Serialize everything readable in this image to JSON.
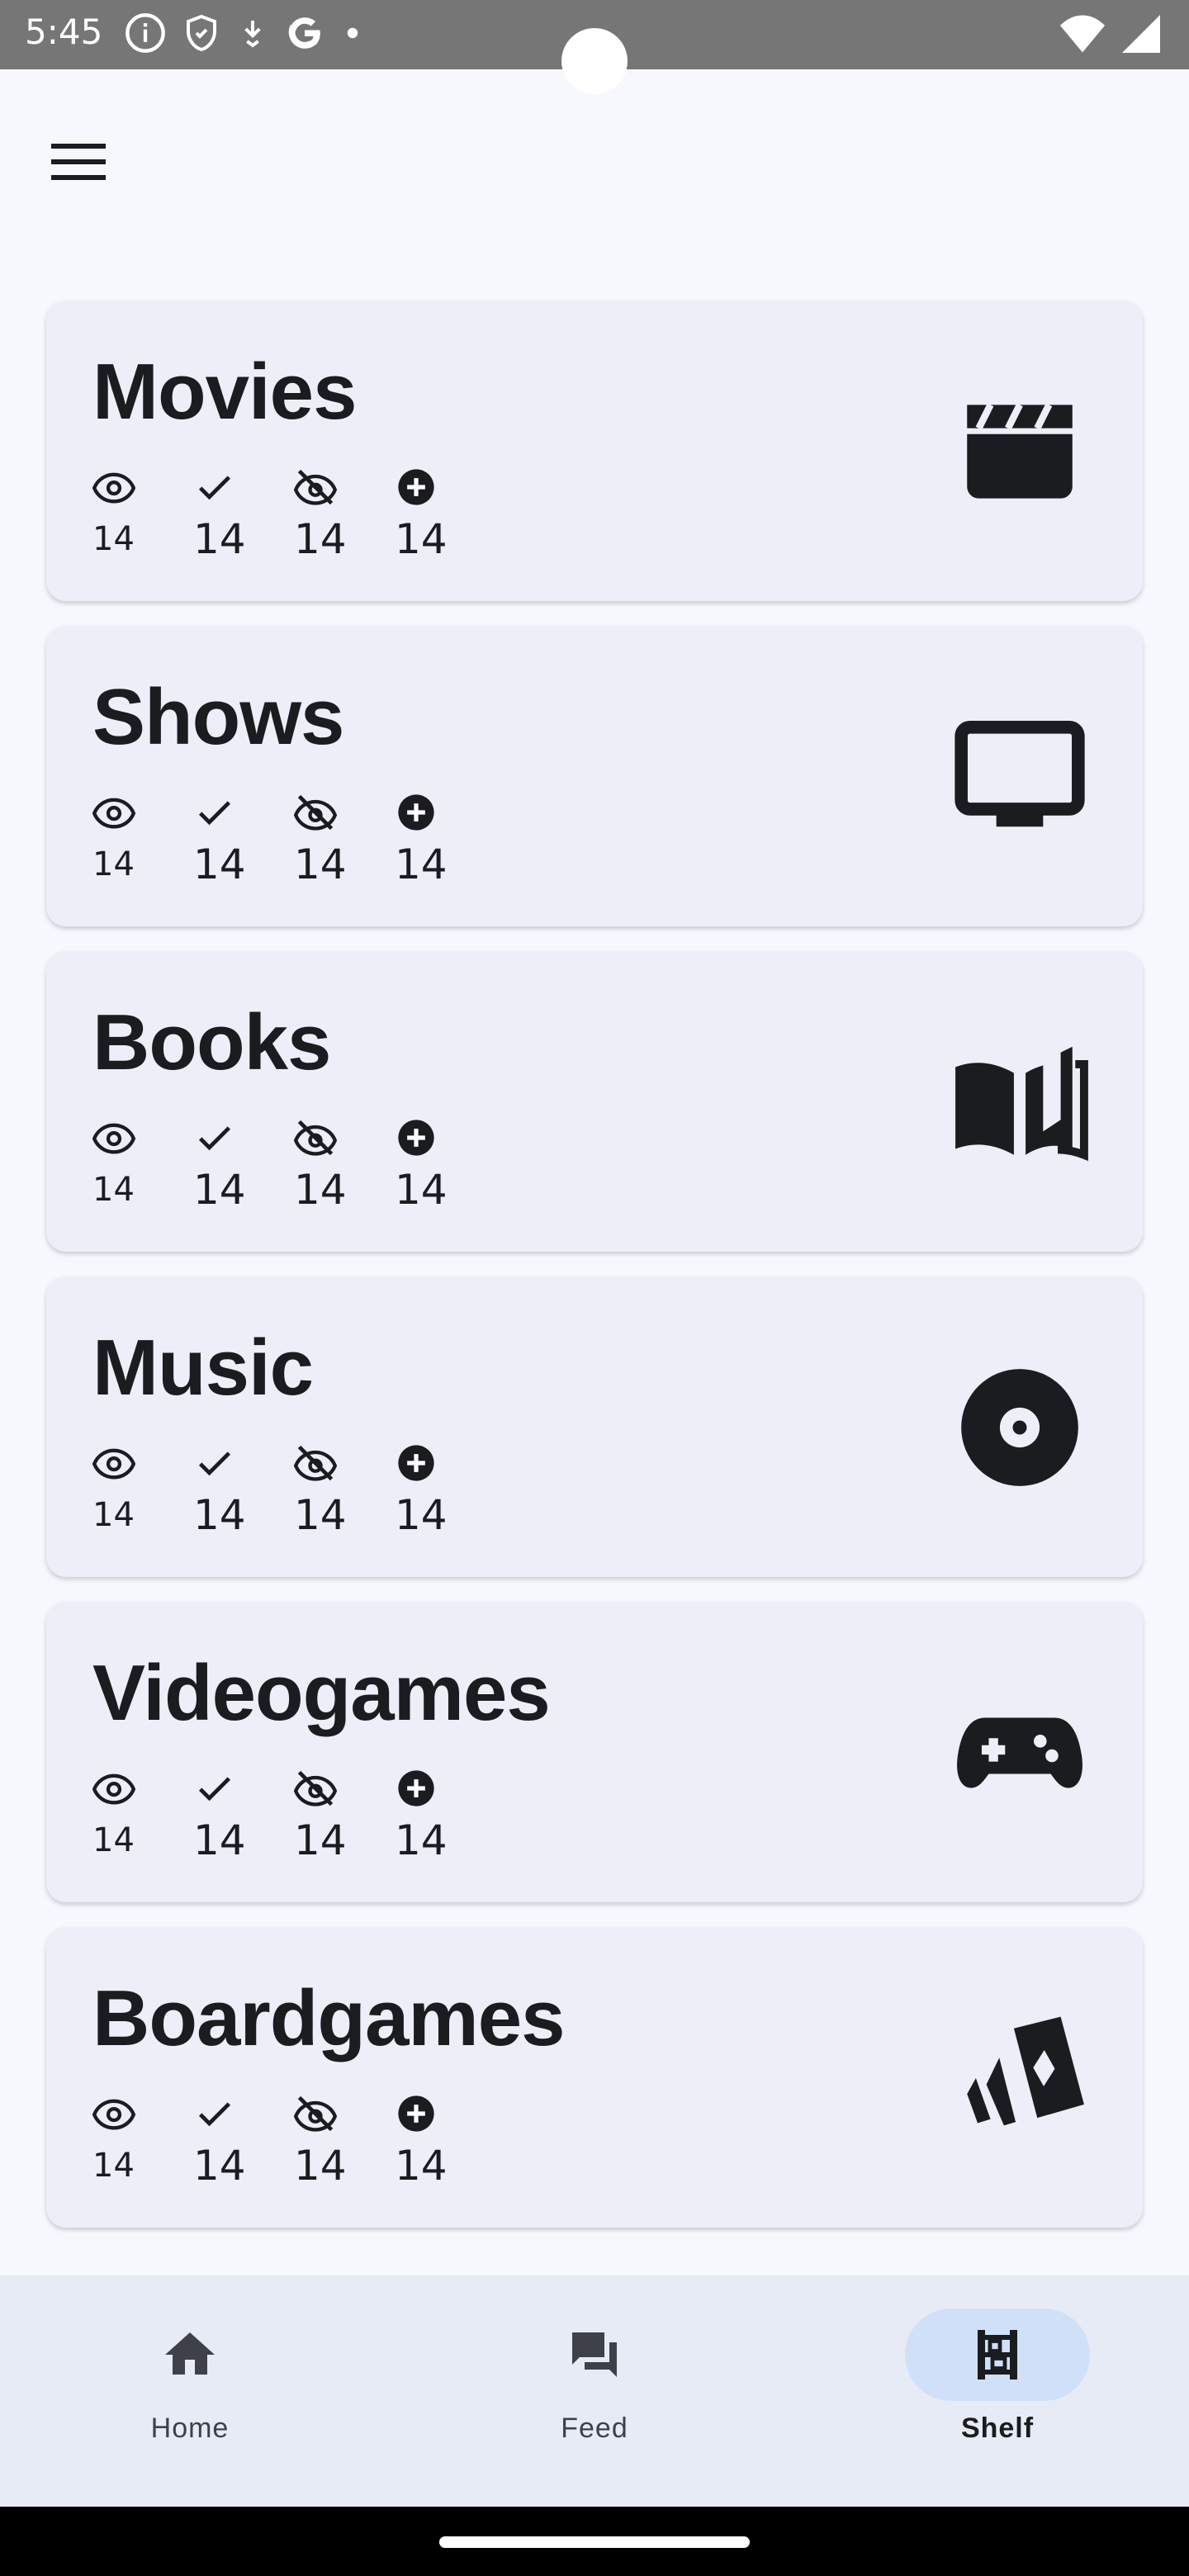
{
  "status_bar": {
    "time": "5:45",
    "icons": [
      "info-icon",
      "shield-icon",
      "download-icon",
      "google-icon",
      "dot-icon",
      "wifi-icon",
      "signal-icon"
    ]
  },
  "menu": {
    "icon": "hamburger-menu-icon"
  },
  "categories": [
    {
      "title": "Movies",
      "icon": "clapperboard-icon",
      "watching": "14",
      "done": "14",
      "hidden": "14",
      "planned": "14"
    },
    {
      "title": "Shows",
      "icon": "tv-icon",
      "watching": "14",
      "done": "14",
      "hidden": "14",
      "planned": "14"
    },
    {
      "title": "Books",
      "icon": "book-icon",
      "watching": "14",
      "done": "14",
      "hidden": "14",
      "planned": "14"
    },
    {
      "title": "Music",
      "icon": "disc-icon",
      "watching": "14",
      "done": "14",
      "hidden": "14",
      "planned": "14"
    },
    {
      "title": "Videogames",
      "icon": "gamepad-icon",
      "watching": "14",
      "done": "14",
      "hidden": "14",
      "planned": "14"
    },
    {
      "title": "Boardgames",
      "icon": "playing-cards-icon",
      "watching": "14",
      "done": "14",
      "hidden": "14",
      "planned": "14"
    }
  ],
  "stat_icons": [
    "eye-icon",
    "check-icon",
    "eye-off-icon",
    "plus-circle-icon"
  ],
  "bottom_nav": {
    "items": [
      {
        "label": "Home",
        "icon": "home-icon",
        "active": false
      },
      {
        "label": "Feed",
        "icon": "forum-icon",
        "active": false
      },
      {
        "label": "Shelf",
        "icon": "shelf-icon",
        "active": true
      }
    ]
  },
  "colors": {
    "background": "#f6f8fd",
    "card": "#eceff8",
    "nav_background": "#e7ebf5",
    "active_pill": "#cfe0f8",
    "text": "#1b1c20"
  }
}
